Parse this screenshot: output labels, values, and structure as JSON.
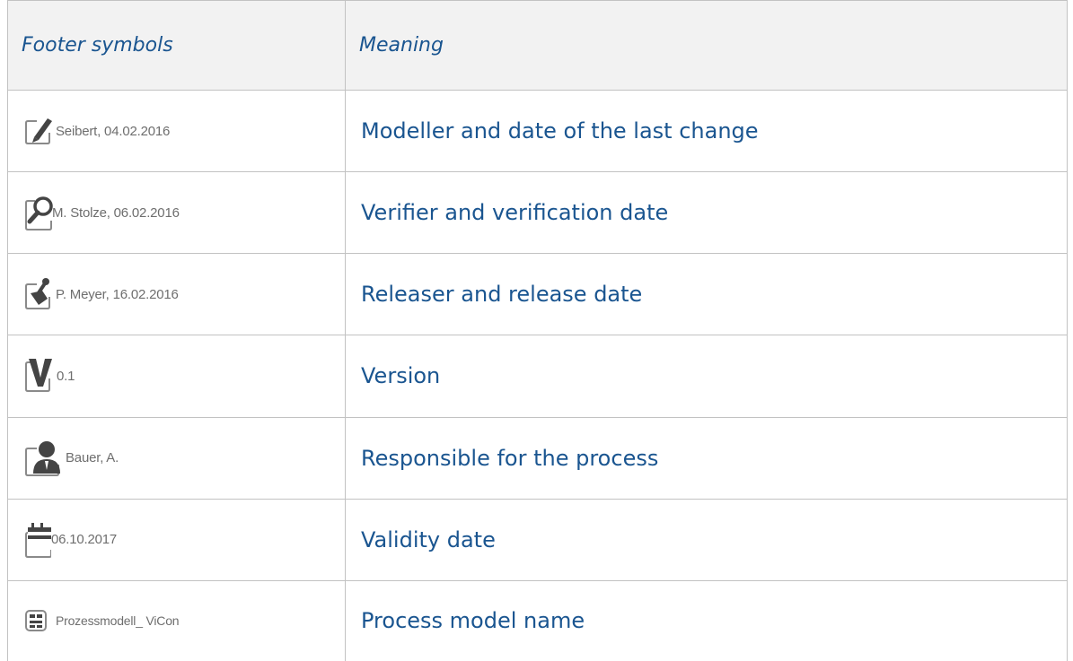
{
  "header": {
    "symbols": "Footer symbols",
    "meaning": "Meaning"
  },
  "rows": [
    {
      "icon": "pencil-icon",
      "symbol_text": "Seibert, 04.02.2016",
      "meaning": "Modeller and date of the last change"
    },
    {
      "icon": "magnifier-icon",
      "symbol_text": "M. Stolze, 06.02.2016",
      "meaning": "Verifier and verification date"
    },
    {
      "icon": "stamp-icon",
      "symbol_text": "P. Meyer, 16.02.2016",
      "meaning": "Releaser and release date"
    },
    {
      "icon": "version-v-icon",
      "symbol_text": "0.1",
      "meaning": "Version"
    },
    {
      "icon": "person-icon",
      "symbol_text": "Bauer, A.",
      "meaning": "Responsible for the process"
    },
    {
      "icon": "calendar-icon",
      "symbol_text": "06.10.2017",
      "meaning": "Validity date"
    },
    {
      "icon": "process-model-icon",
      "symbol_text": "Prozessmodell_ ViCon",
      "meaning": "Process model name"
    }
  ],
  "colors": {
    "header_background": "#f2f2f2",
    "accent_text": "#1a5590",
    "border": "#c2c2c2",
    "symbol_text": "#6e6e6e",
    "icon_gray": "#8a8a8a",
    "icon_fill": "#444444"
  }
}
